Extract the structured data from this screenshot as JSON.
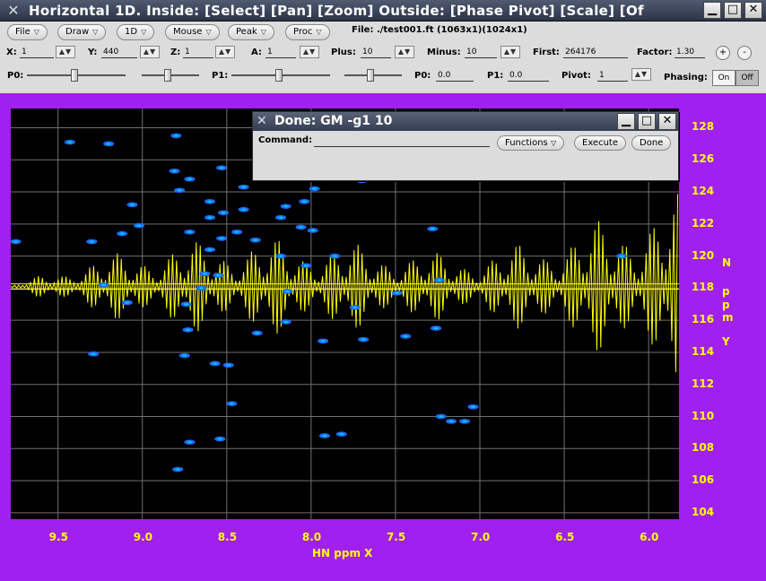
{
  "window": {
    "title": "Horizontal 1D.   Inside: [Select] [Pan] [Zoom]   Outside: [Phase Pivot] [Scale] [Of",
    "icon": "x-app-icon",
    "controls": [
      "minimize-icon",
      "maximize-icon",
      "close-icon"
    ]
  },
  "menus": [
    {
      "label": "File"
    },
    {
      "label": "Draw"
    },
    {
      "label": "1D"
    },
    {
      "label": "Mouse"
    },
    {
      "label": "Peak"
    },
    {
      "label": "Proc"
    }
  ],
  "file_info": "File: ./test001.ft (1063x1)(1024x1)",
  "params": {
    "x_label": "X:",
    "x_value": "1",
    "y_label": "Y:",
    "y_value": "440",
    "z_label": "Z:",
    "z_value": "1",
    "a_label": "A:",
    "a_value": "1",
    "plus_label": "Plus:",
    "plus_value": "10",
    "minus_label": "Minus:",
    "minus_value": "10",
    "first_label": "First:",
    "first_value": "264176",
    "factor_label": "Factor:",
    "factor_value": "1.30",
    "zoom_in": "+",
    "zoom_out": "-"
  },
  "phase": {
    "p0_label": "P0:",
    "p1_label": "P1:",
    "p0_value_label": "P0:",
    "p0_value": "0.0",
    "p1_value_label": "P1:",
    "p1_value": "0.0",
    "pivot_label": "Pivot:",
    "pivot_value": "1",
    "phasing_label": "Phasing:",
    "on_label": "On",
    "off_label": "Off",
    "sliders": {
      "p0": 0.48,
      "p0_fine": 0.45,
      "p1": 0.48,
      "p1_fine": 0.45
    }
  },
  "dialog": {
    "title": "Done: GM -g1 10",
    "command_label": "Command:",
    "command_value": "",
    "functions_label": "Functions",
    "execute_label": "Execute",
    "done_label": "Done"
  },
  "colors": {
    "background": "#a020f0",
    "plot_bg": "#000000",
    "axis_text": "#ffff00",
    "trace": "#ffff00",
    "peaks": "#1e6cff",
    "grid": "#707070"
  },
  "chart_data": {
    "type": "scatter",
    "xlabel": "HN ppm X",
    "ylabel": "N ppm Y",
    "xlim": [
      9.78,
      5.82
    ],
    "ylim": [
      129.2,
      103.6
    ],
    "x_ticks": [
      "9.5",
      "9.0",
      "8.5",
      "8.0",
      "7.5",
      "7.0",
      "6.5",
      "6.0"
    ],
    "y_ticks": [
      "104",
      "106",
      "108",
      "110",
      "112",
      "114",
      "116",
      "118",
      "120",
      "122",
      "124",
      "126",
      "128"
    ],
    "trace_baseline": 118.1,
    "peaks": [
      {
        "x": 8.79,
        "y": 106.7
      },
      {
        "x": 8.72,
        "y": 108.4
      },
      {
        "x": 8.54,
        "y": 108.6
      },
      {
        "x": 8.47,
        "y": 110.8
      },
      {
        "x": 7.92,
        "y": 108.8
      },
      {
        "x": 7.82,
        "y": 108.9
      },
      {
        "x": 7.23,
        "y": 110.0
      },
      {
        "x": 7.17,
        "y": 109.7
      },
      {
        "x": 7.09,
        "y": 109.7
      },
      {
        "x": 7.04,
        "y": 110.6
      },
      {
        "x": 9.29,
        "y": 113.9
      },
      {
        "x": 8.75,
        "y": 113.8
      },
      {
        "x": 8.57,
        "y": 113.3
      },
      {
        "x": 8.49,
        "y": 113.2
      },
      {
        "x": 8.73,
        "y": 115.4
      },
      {
        "x": 8.32,
        "y": 115.2
      },
      {
        "x": 8.15,
        "y": 115.9
      },
      {
        "x": 7.93,
        "y": 114.7
      },
      {
        "x": 7.69,
        "y": 114.8
      },
      {
        "x": 7.44,
        "y": 115.0
      },
      {
        "x": 7.26,
        "y": 115.5
      },
      {
        "x": 8.74,
        "y": 117.0
      },
      {
        "x": 9.09,
        "y": 117.1
      },
      {
        "x": 8.65,
        "y": 118.0
      },
      {
        "x": 8.14,
        "y": 117.8
      },
      {
        "x": 7.74,
        "y": 116.8
      },
      {
        "x": 7.49,
        "y": 117.7
      },
      {
        "x": 9.23,
        "y": 118.2
      },
      {
        "x": 8.63,
        "y": 118.9
      },
      {
        "x": 8.55,
        "y": 118.8
      },
      {
        "x": 8.03,
        "y": 119.4
      },
      {
        "x": 7.86,
        "y": 120.0
      },
      {
        "x": 7.24,
        "y": 118.5
      },
      {
        "x": 9.3,
        "y": 120.9
      },
      {
        "x": 9.12,
        "y": 121.4
      },
      {
        "x": 9.02,
        "y": 121.9
      },
      {
        "x": 8.72,
        "y": 121.5
      },
      {
        "x": 8.53,
        "y": 121.1
      },
      {
        "x": 8.44,
        "y": 121.5
      },
      {
        "x": 8.33,
        "y": 121.0
      },
      {
        "x": 8.18,
        "y": 120.0
      },
      {
        "x": 8.6,
        "y": 120.4
      },
      {
        "x": 8.06,
        "y": 121.8
      },
      {
        "x": 7.99,
        "y": 121.6
      },
      {
        "x": 8.6,
        "y": 122.4
      },
      {
        "x": 8.52,
        "y": 122.7
      },
      {
        "x": 8.4,
        "y": 122.9
      },
      {
        "x": 8.18,
        "y": 122.4
      },
      {
        "x": 9.06,
        "y": 123.2
      },
      {
        "x": 8.6,
        "y": 123.4
      },
      {
        "x": 8.15,
        "y": 123.1
      },
      {
        "x": 8.04,
        "y": 123.4
      },
      {
        "x": 7.28,
        "y": 121.7
      },
      {
        "x": 8.78,
        "y": 124.1
      },
      {
        "x": 8.4,
        "y": 124.3
      },
      {
        "x": 7.98,
        "y": 124.2
      },
      {
        "x": 8.72,
        "y": 124.8
      },
      {
        "x": 7.7,
        "y": 124.7
      },
      {
        "x": 8.81,
        "y": 125.3
      },
      {
        "x": 8.53,
        "y": 125.5
      },
      {
        "x": 9.43,
        "y": 127.1
      },
      {
        "x": 9.2,
        "y": 127.0
      },
      {
        "x": 8.8,
        "y": 127.5
      },
      {
        "x": 8.15,
        "y": 128.0
      },
      {
        "x": 7.04,
        "y": 128.9
      },
      {
        "x": 9.75,
        "y": 120.9
      },
      {
        "x": 6.16,
        "y": 120.0
      }
    ]
  }
}
